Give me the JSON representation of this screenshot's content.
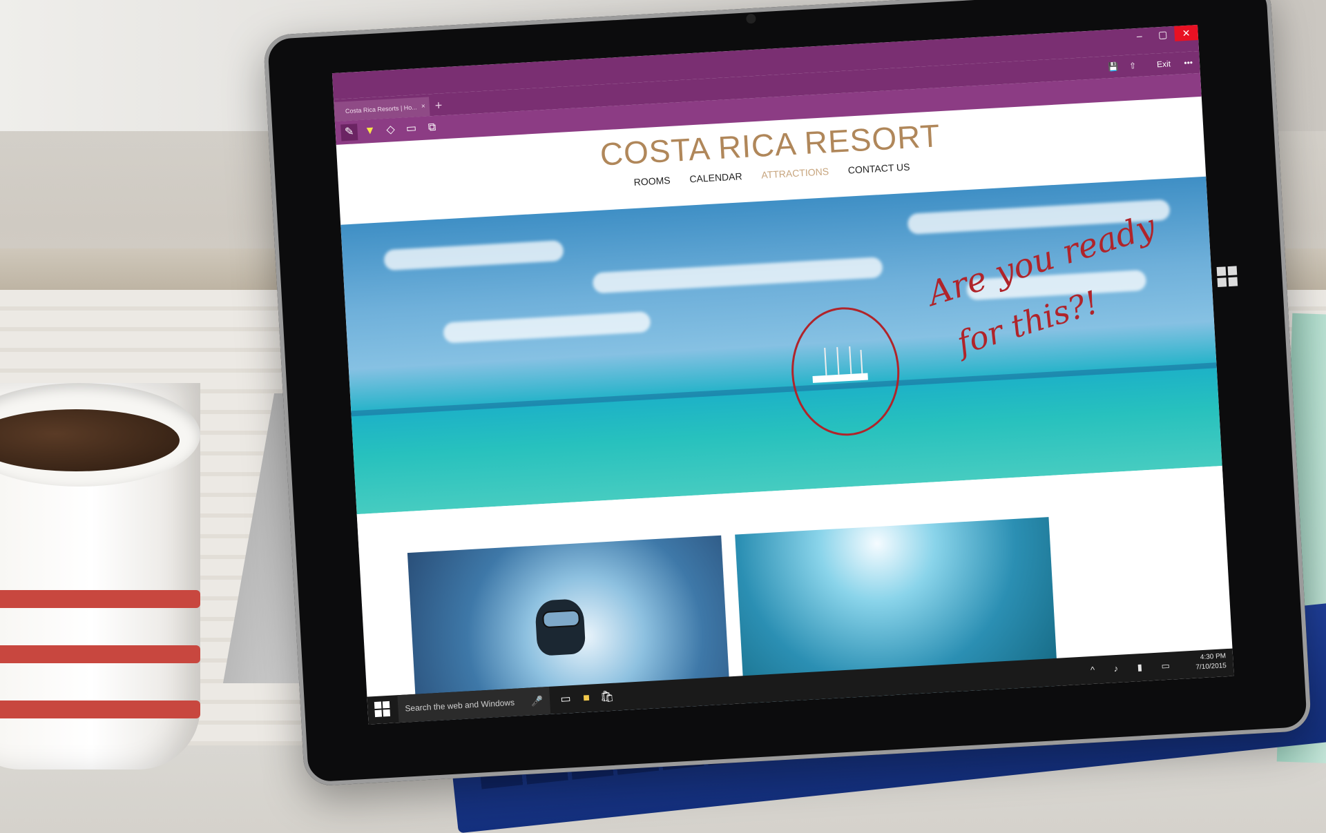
{
  "browser": {
    "tab_title": "Costa Rica Resorts | Ho...",
    "tab_close": "×",
    "new_tab": "+",
    "window_controls": [
      "–",
      "▢",
      "✕"
    ],
    "exit_label": "Exit",
    "more_label": "•••",
    "toolbar_icons": [
      "pen-icon",
      "highlighter-icon",
      "eraser-icon",
      "comment-icon",
      "clip-icon"
    ],
    "right_icons": [
      "save-icon",
      "share-icon"
    ]
  },
  "site": {
    "title": "COSTA RICA RESORT",
    "nav": [
      "ROOMS",
      "CALENDAR",
      "ATTRACTIONS",
      "CONTACT US"
    ],
    "active_nav": "ATTRACTIONS"
  },
  "annotation": {
    "line1": "Are you ready",
    "line2": "for this?!",
    "ink_color": "#b0242a"
  },
  "taskbar": {
    "search_placeholder": "Search the web and Windows",
    "time": "4:30 PM",
    "date": "7/10/2015"
  },
  "colors": {
    "accent": "#7a2f72",
    "title_color": "#b0875a"
  }
}
